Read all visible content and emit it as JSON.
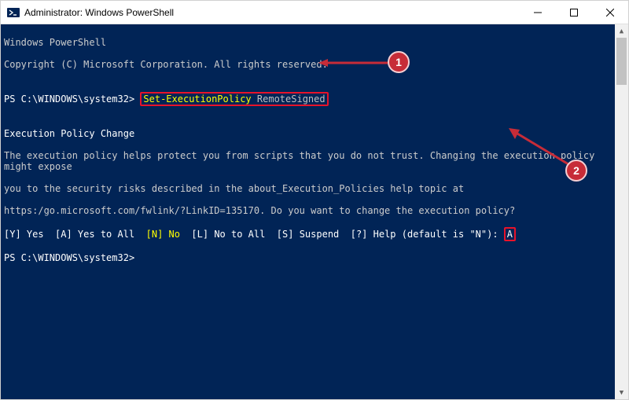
{
  "titlebar": {
    "title": "Administrator: Windows PowerShell"
  },
  "terminal": {
    "header1": "Windows PowerShell",
    "header2": "Copyright (C) Microsoft Corporation. All rights reserved.",
    "blank": "",
    "prompt1_prefix": "PS C:\\WINDOWS\\system32> ",
    "command_yellow": "Set-ExecutionPolicy",
    "command_gray": " RemoteSigned",
    "section_title": "Execution Policy Change",
    "body1": "The execution policy helps protect you from scripts that you do not trust. Changing the execution policy might expose",
    "body2": "you to the security risks described in the about_Execution_Policies help topic at",
    "body3": "https:/go.microsoft.com/fwlink/?LinkID=135170. Do you want to change the execution policy?",
    "opts_pre": "[Y] Yes  [A] Yes to All  ",
    "opts_n": "[N] No",
    "opts_post": "  [L] No to All  [S] Suspend  [?] Help (default is \"N\"): ",
    "input_a": "A",
    "prompt2": "PS C:\\WINDOWS\\system32>"
  },
  "annotations": {
    "badge1": "1",
    "badge2": "2"
  }
}
